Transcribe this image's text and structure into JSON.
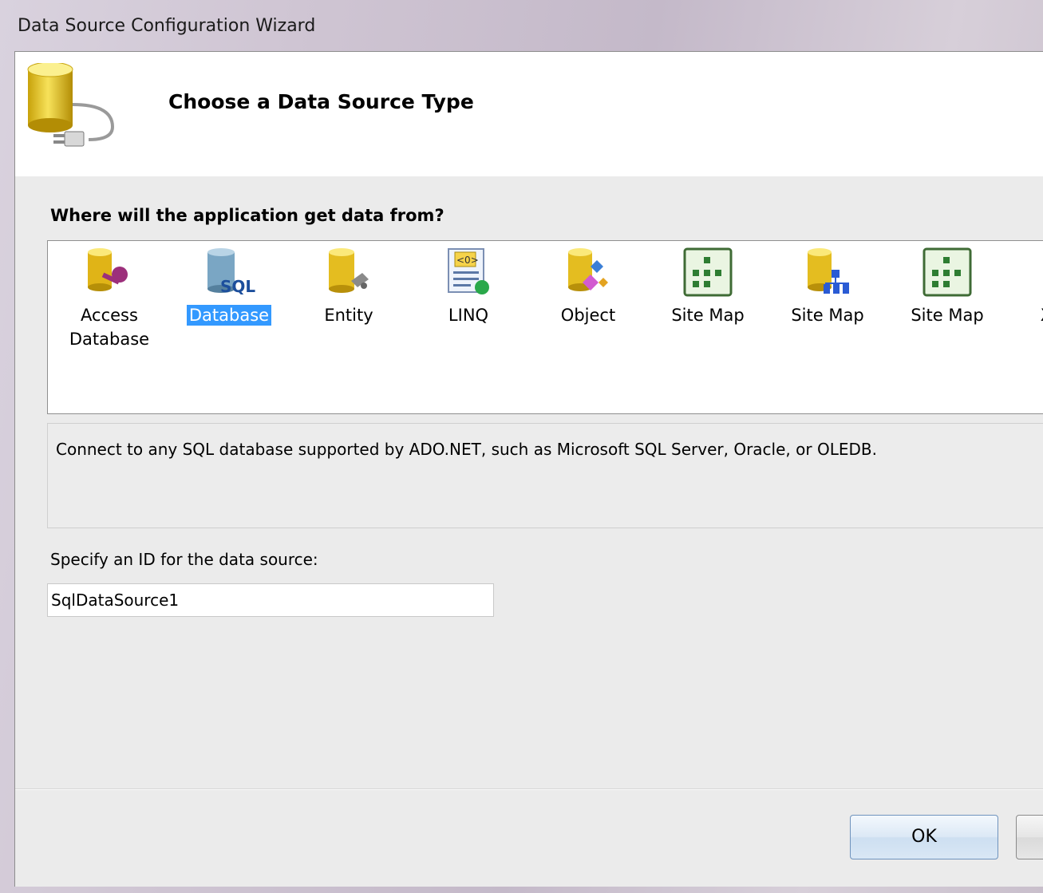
{
  "window": {
    "title": "Data Source Configuration Wizard"
  },
  "header": {
    "title": "Choose a Data Source Type",
    "icon": "database-plug-icon"
  },
  "question": "Where will the application get data from?",
  "data_sources": [
    {
      "label_lines": [
        "Access",
        "Database"
      ],
      "icon": "access-database-icon",
      "selected": false
    },
    {
      "label_lines": [
        "Database"
      ],
      "icon": "sql-database-icon",
      "selected": true
    },
    {
      "label_lines": [
        "Entity"
      ],
      "icon": "entity-icon",
      "selected": false
    },
    {
      "label_lines": [
        "LINQ"
      ],
      "icon": "linq-icon",
      "selected": false
    },
    {
      "label_lines": [
        "Object"
      ],
      "icon": "object-icon",
      "selected": false
    },
    {
      "label_lines": [
        "Site Map"
      ],
      "icon": "site-map-icon",
      "selected": false
    },
    {
      "label_lines": [
        "Site Map"
      ],
      "icon": "site-map-hierarchy-icon",
      "selected": false
    },
    {
      "label_lines": [
        "Site Map"
      ],
      "icon": "site-map-icon",
      "selected": false
    },
    {
      "label_lines": [
        "X"
      ],
      "icon": "xml-icon",
      "selected": false
    }
  ],
  "description": "Connect to any SQL database supported by ADO.NET, such as Microsoft SQL Server, Oracle, or OLEDB.",
  "id_field": {
    "label": "Specify an ID for the data source:",
    "value": "SqlDataSource1"
  },
  "buttons": {
    "ok": "OK",
    "cancel": ""
  },
  "colors": {
    "selection": "#3399ff",
    "db_yellow": "#e8c21c"
  }
}
